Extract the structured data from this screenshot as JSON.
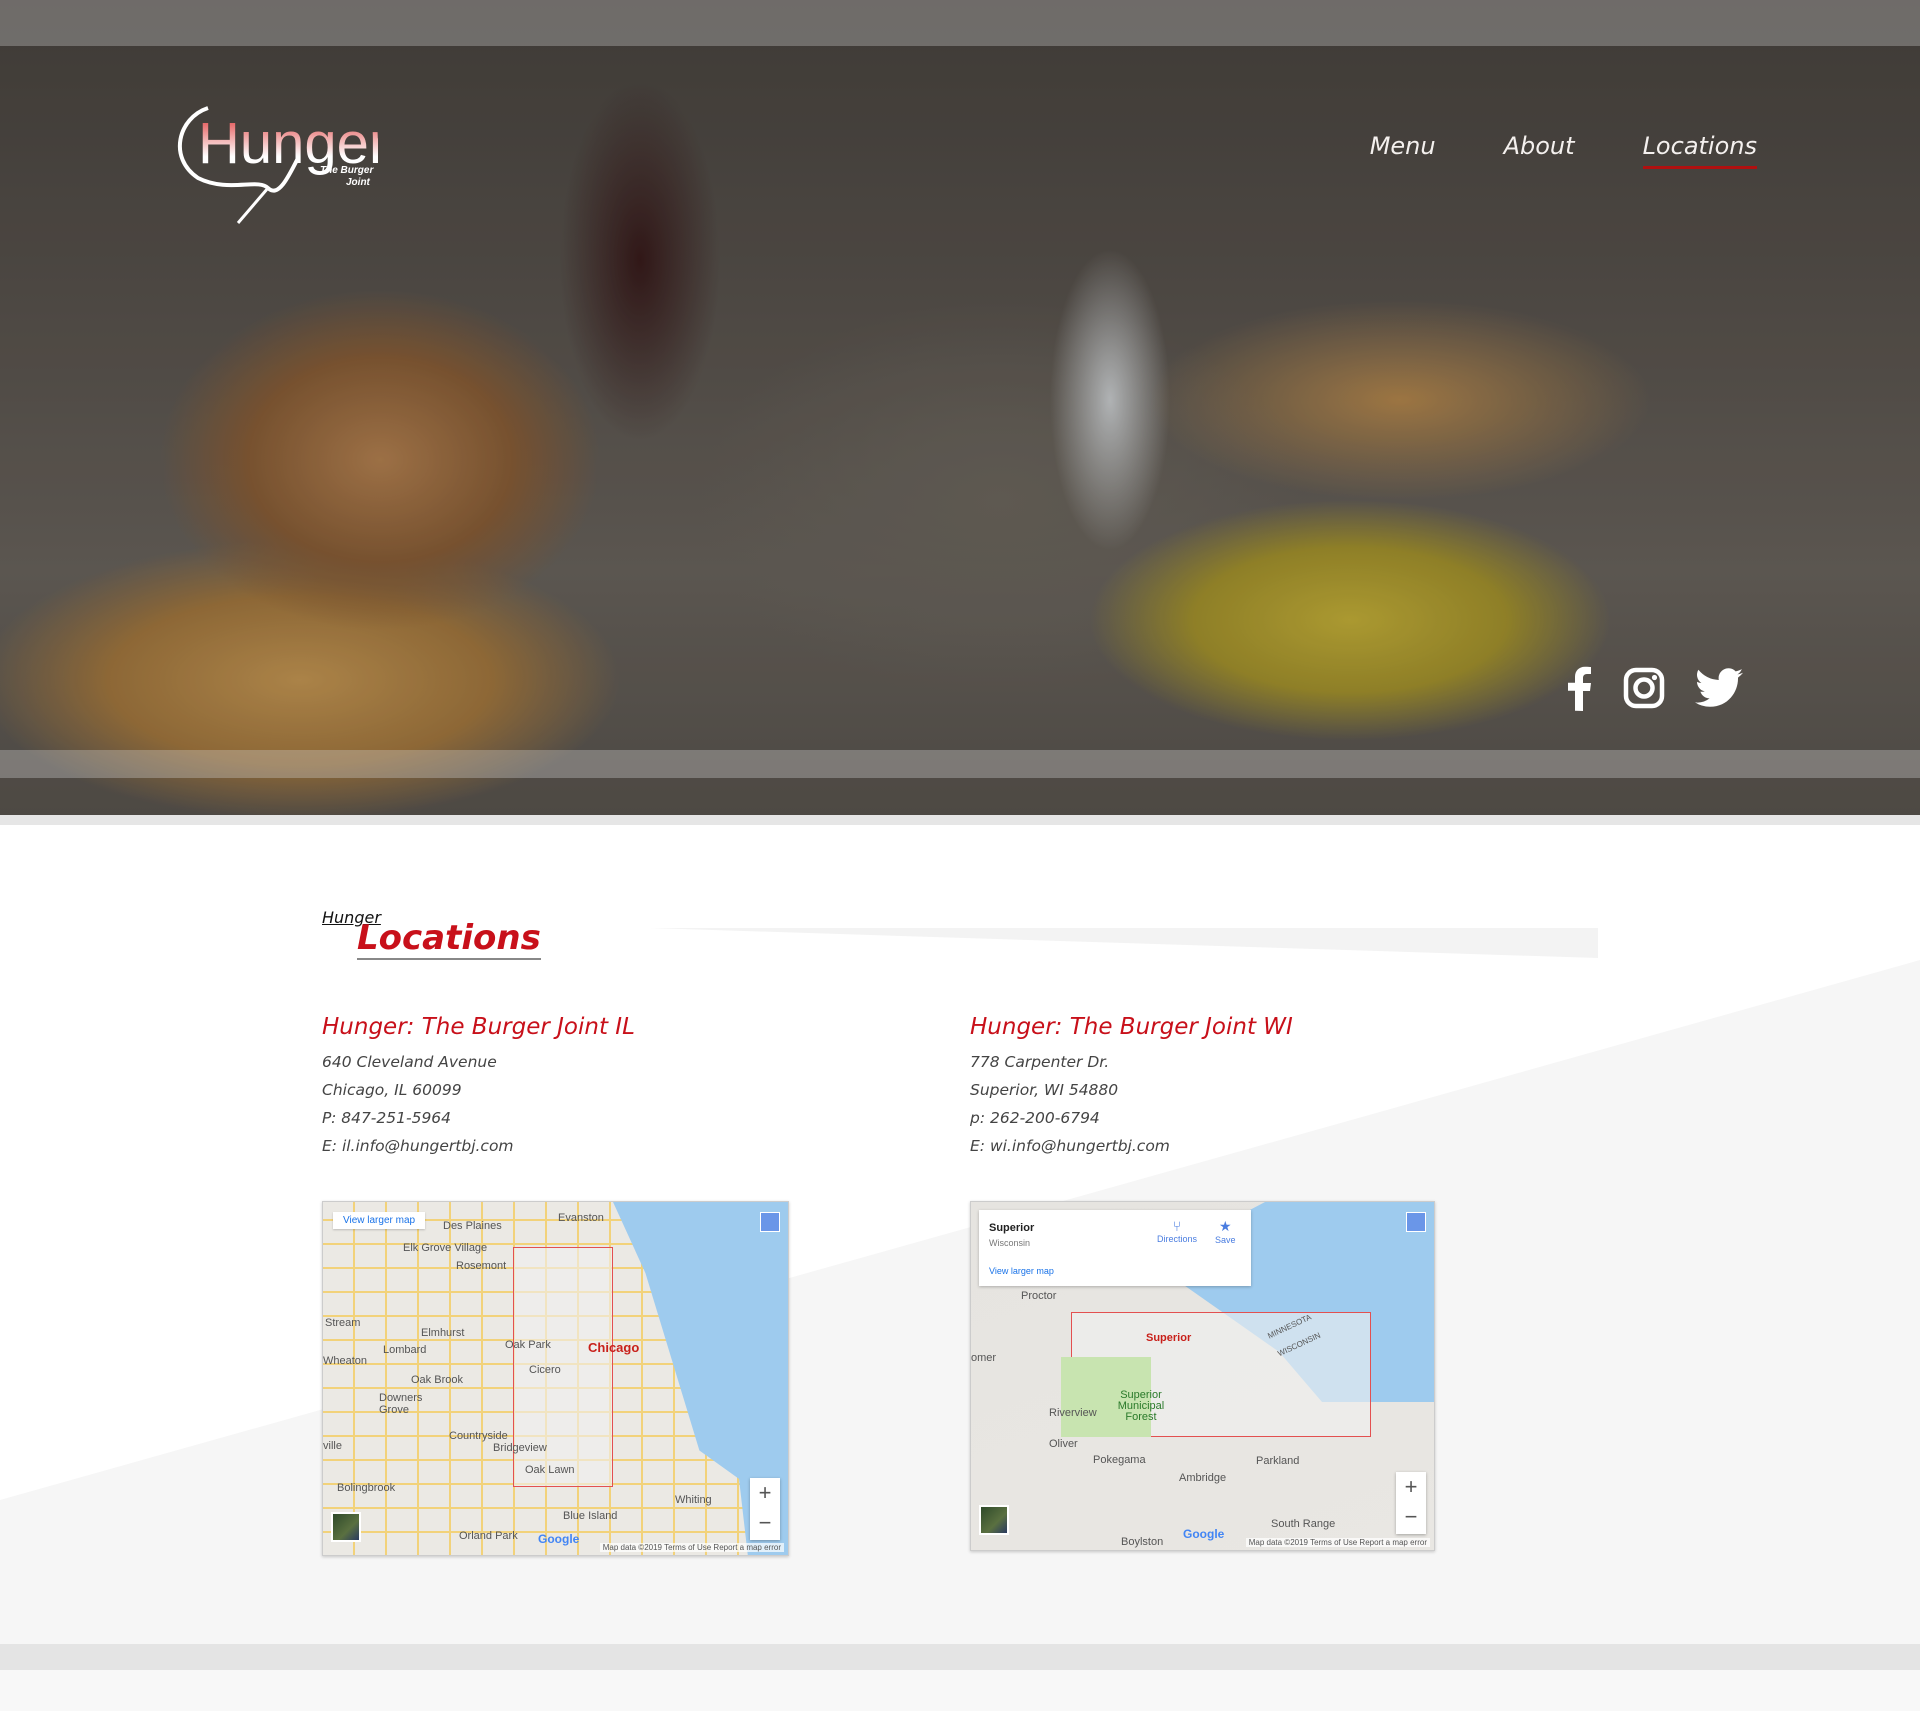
{
  "brand": {
    "logo_text": "Hunger",
    "logo_tagline_1": "The Burger",
    "logo_tagline_2": "Joint"
  },
  "nav": {
    "items": [
      {
        "label": "Menu"
      },
      {
        "label": "About"
      },
      {
        "label": "Locations",
        "active": true
      }
    ]
  },
  "social": {
    "icons": [
      "facebook-icon",
      "instagram-icon",
      "twitter-icon"
    ]
  },
  "section": {
    "subtitle": "Hunger",
    "title": "Locations"
  },
  "locations": [
    {
      "name": "Hunger: The Burger Joint IL",
      "street": "640 Cleveland Avenue",
      "city": "Chicago, IL 60099",
      "phone": "P: 847-251-5964",
      "email": "E: il.info@hungertbj.com",
      "map": {
        "view_larger": "View larger map",
        "labels": [
          "Evanston",
          "Des Plaines",
          "Elk Grove Village",
          "Rosemont",
          "Stream",
          "Elmhurst",
          "Lombard",
          "Wheaton",
          "Oak Park",
          "Oak Brook",
          "Cicero",
          "Downers Grove",
          "Countryside",
          "Bridgeview",
          "ville",
          "Oak Lawn",
          "Bolingbrook",
          "Blue Island",
          "Orland Park",
          "Whiting"
        ],
        "city": "Chicago",
        "attribution": "Map data ©2019  Terms of Use  Report a map error",
        "google": "Google"
      }
    },
    {
      "name": "Hunger: The Burger Joint WI",
      "street": "778 Carpenter Dr.",
      "city": "Superior, WI 54880",
      "phone": "p: 262-200-6794",
      "email": "E: wi.info@hungertbj.com",
      "map": {
        "place": "Superior",
        "region": "Wisconsin",
        "directions": "Directions",
        "save": "Save",
        "view_larger": "View larger map",
        "labels": [
          "Proctor",
          "omer",
          "Riverview",
          "Superior Municipal Forest",
          "Oliver",
          "Pokegama",
          "Ambridge",
          "Parkland",
          "South Range",
          "Boylston",
          "MINNESOTA",
          "WISCONSIN"
        ],
        "city": "Superior",
        "attribution": "Map data ©2019  Terms of Use  Report a map error",
        "google": "Google"
      }
    }
  ],
  "colors": {
    "accent": "#c8101a",
    "text": "#444444"
  }
}
